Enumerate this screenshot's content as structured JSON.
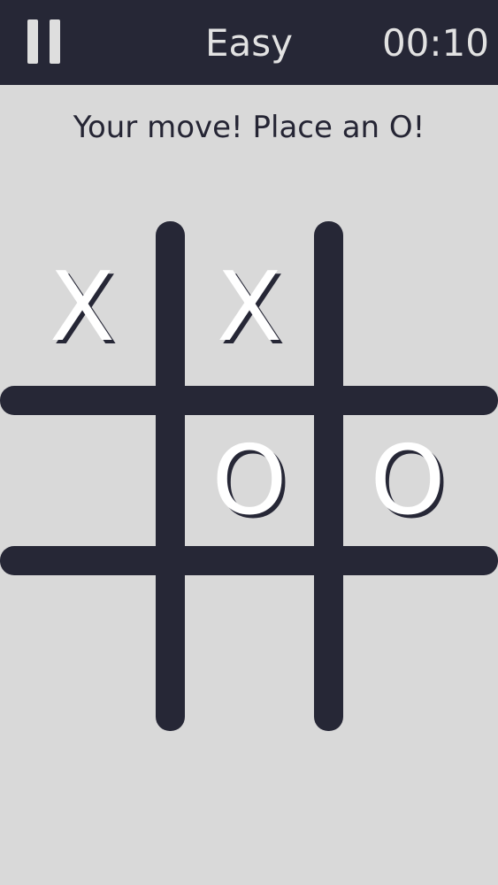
{
  "header": {
    "pause_icon": "pause-icon",
    "difficulty": "Easy",
    "timer": "00:10"
  },
  "status_message": "Your move! Place an O!",
  "board": {
    "cells": [
      "X",
      "X",
      "",
      "",
      "O",
      "O",
      "",
      "",
      ""
    ]
  },
  "colors": {
    "header_bg": "#262736",
    "page_bg": "#d9d9d9",
    "grid": "#262736",
    "mark": "#ffffff",
    "mark_shadow": "#262736"
  }
}
